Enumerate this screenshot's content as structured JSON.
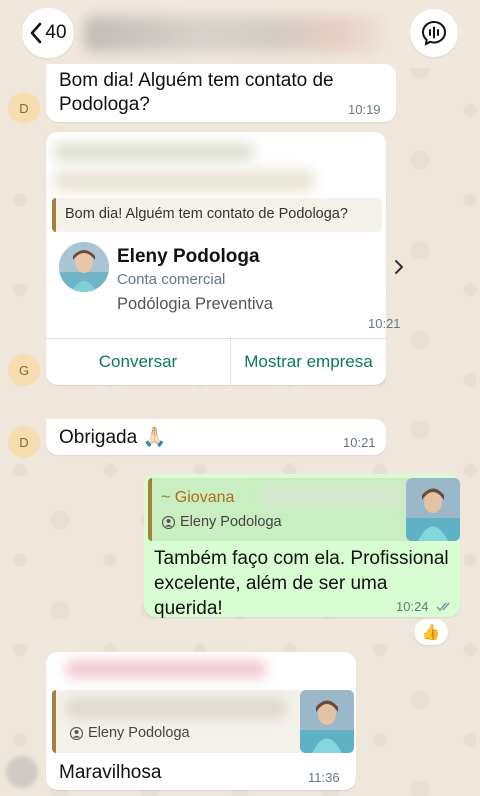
{
  "header": {
    "back_count": "40",
    "back_icon": "chevron-left-icon",
    "action_icon": "waveform-chat-icon"
  },
  "messages": [
    {
      "avatar": "D",
      "text_line1": "Bom dia! Alguém tem contato de",
      "text_line2": "Podologa?",
      "time": "10:19"
    },
    {
      "avatar": "G",
      "quoted_text": "Bom dia! Alguém tem contato de Podologa?",
      "card": {
        "name": "Eleny Podologa",
        "account_type": "Conta comercial",
        "category": "Podólogia Preventiva",
        "chevron_icon": "chevron-right-icon"
      },
      "time": "10:21",
      "actions": [
        "Conversar",
        "Mostrar empresa"
      ]
    },
    {
      "avatar": "D",
      "text": "Obrigada 🙏🏻",
      "time": "10:21"
    },
    {
      "quote_author": "~ Giovana",
      "quote_contact": "Eleny Podologa",
      "text_line1": "Também faço com ela. Profissional",
      "text_line2": "excelente, além de ser uma querida!",
      "time": "10:24",
      "status_icon": "double-check-icon",
      "reaction": "👍"
    },
    {
      "quote_contact": "Eleny Podologa",
      "text": "Maravilhosa",
      "time": "11:36"
    }
  ],
  "colors": {
    "outgoing_bubble": "#d9fdd3",
    "accent_green": "#0d7a55",
    "quote_bar": "#a3823c",
    "author_name": "#b06b1f"
  }
}
